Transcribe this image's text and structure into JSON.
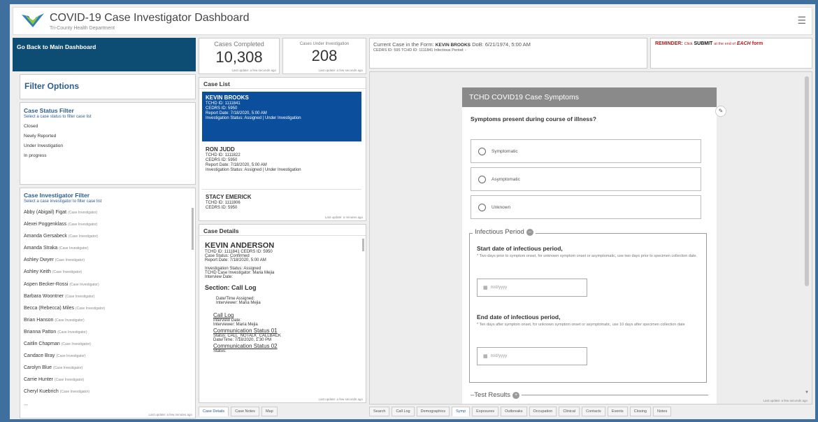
{
  "header": {
    "title": "COVID-19 Case Investigator Dashboard",
    "subtitle": "Tri-County Health Department",
    "menu_icon": "hamburger-icon"
  },
  "nav": {
    "back_label": "Go Back to Main Dashboard"
  },
  "filters": {
    "title": "Filter Options",
    "status": {
      "title": "Case Status Filter",
      "help": "Select a case status to filter case list",
      "items": [
        "Closed",
        "Newly Reported",
        "Under Investigation",
        "In progress"
      ]
    },
    "investigator": {
      "title": "Case Investigator Filter",
      "help": "Select a case investigator to filter case list",
      "role": "(Case Investigator)",
      "items": [
        "Abby (Abigail) Figat",
        "Alexei Poggenklass",
        "Amanda Gersabeck",
        "Amanda Straka",
        "Ashley Dwyer",
        "Ashley Keith",
        "Aspen Becker-Rossi",
        "Barbara Woontner",
        "Becca (Rebecca) Miles",
        "Brian Hanson",
        "Brianna Patton",
        "Caitlin Chapman",
        "Candace Bray",
        "Carolyn Blue",
        "Carrie Hunter",
        "Cheryl Kuebrich",
        "..."
      ],
      "last_update": "Last update: a few minutes ago"
    }
  },
  "stats": {
    "completed_label": "Cases Completed",
    "completed_value": "10,308",
    "completed_update": "Last update: a few seconds ago",
    "under_label": "Cases Under Investigation",
    "under_value": "208",
    "under_update": "Last update: a few seconds ago"
  },
  "case_list": {
    "title": "Case List",
    "last_update": "Last update: a minutes ago",
    "cases": [
      {
        "name": "KEVIN BROOKS",
        "tchd": "TCHD ID: 1111841",
        "cedrs": "CEDRS ID: 5950",
        "report": "Report Date: 7/18/2020, 5:00 AM",
        "status": "Investigation Status: Assigned | Under Investigation"
      },
      {
        "name": "RON JUDD",
        "tchd": "TCHD ID: 1111822",
        "cedrs": "CEDRS ID: 5950",
        "report": "Report Date: 7/18/2020, 5:00 AM",
        "status": "Investigation Status: Assigned | Under Investigation"
      },
      {
        "name": "STACY EMERICK",
        "tchd": "TCHD ID: 1111806",
        "cedrs": "CEDRS ID: 5950",
        "report": "",
        "status": ""
      }
    ]
  },
  "case_details": {
    "title": "Case Details",
    "name": "KEVIN ANDERSON",
    "ids": "TCHD ID: 1111841   CEDRS ID: 5950",
    "case_status": "Case Status: Confirmed",
    "report_date": "Report Date: 7/18/2020, 5:00 AM",
    "inv_status": "Investigation Status: Assigned",
    "investigator": "TCHD Case Investigator: Maria Mejia",
    "interview_date": "Interview Date:",
    "section": "Section: Call Log",
    "assigned": "Date/Time Assigned:",
    "interviewer": "Interviewer: Maria Mejia",
    "call_log": "Call Log",
    "cl_interview": "Interview Date:",
    "cl_interviewer": "Interviewer: Maria Mejia",
    "comm1": "Communication Status 01",
    "comm1_status": "Status: CALL_NOTALK_CALLBACK",
    "comm1_date": "Date/Time: 7/18/2020, 1:30 PM",
    "comm2": "Communication Status 02",
    "comm2_status": "Status:",
    "last_update": "Last update: a few seconds ago"
  },
  "left_tabs": [
    "Case Details",
    "Case Notes",
    "Map"
  ],
  "current_case": {
    "label": "Current Case in the Form:",
    "name": "KEVIN BROOKS",
    "dob": "DoB: 6/21/1974, 5:00 AM",
    "line2": "CEDRS ID: 595      TCHD ID: 1111841     Infectious Period: -"
  },
  "reminder": {
    "label": "REMINDER:",
    "click": "Click",
    "submit": "SUBMIT",
    "middle": "at the end of",
    "each": "EACH",
    "form": "form"
  },
  "form": {
    "header": "TCHD COVID19 Case Symptoms",
    "question": "Symptoms present during course of illness?",
    "options": [
      "Symptomatic",
      "Asymptomatic",
      "Unknown"
    ],
    "infectious_legend": "Infectious Period",
    "start_label": "Start date of infectious period,",
    "start_help": "* Two days prior to symptom onset, for unknown symptom onset or asymptomatic, use two days prior to specimen collection date.",
    "end_label": "End date of infectious period,",
    "end_help": "* Ten days after symptom onset, for unknown symptom onset or asymptomatic, use 10 days after specimen collection date",
    "date_placeholder": "m/d/yyyy",
    "test_results": "Test Results",
    "last_update": "Last update: a few seconds ago"
  },
  "form_tabs": [
    "Search",
    "Call Log",
    "Demographics",
    "Symp",
    "Exposures",
    "Outbreaks",
    "Occupation",
    "Clinical",
    "Contacts",
    "Events",
    "Closing",
    "Notes"
  ],
  "active_form_tab": "Symp",
  "colors": {
    "brand_blue": "#0e4d73",
    "selected": "#0b4f9c",
    "reminder_red": "#c0171a",
    "background": "#3f6f9e"
  }
}
